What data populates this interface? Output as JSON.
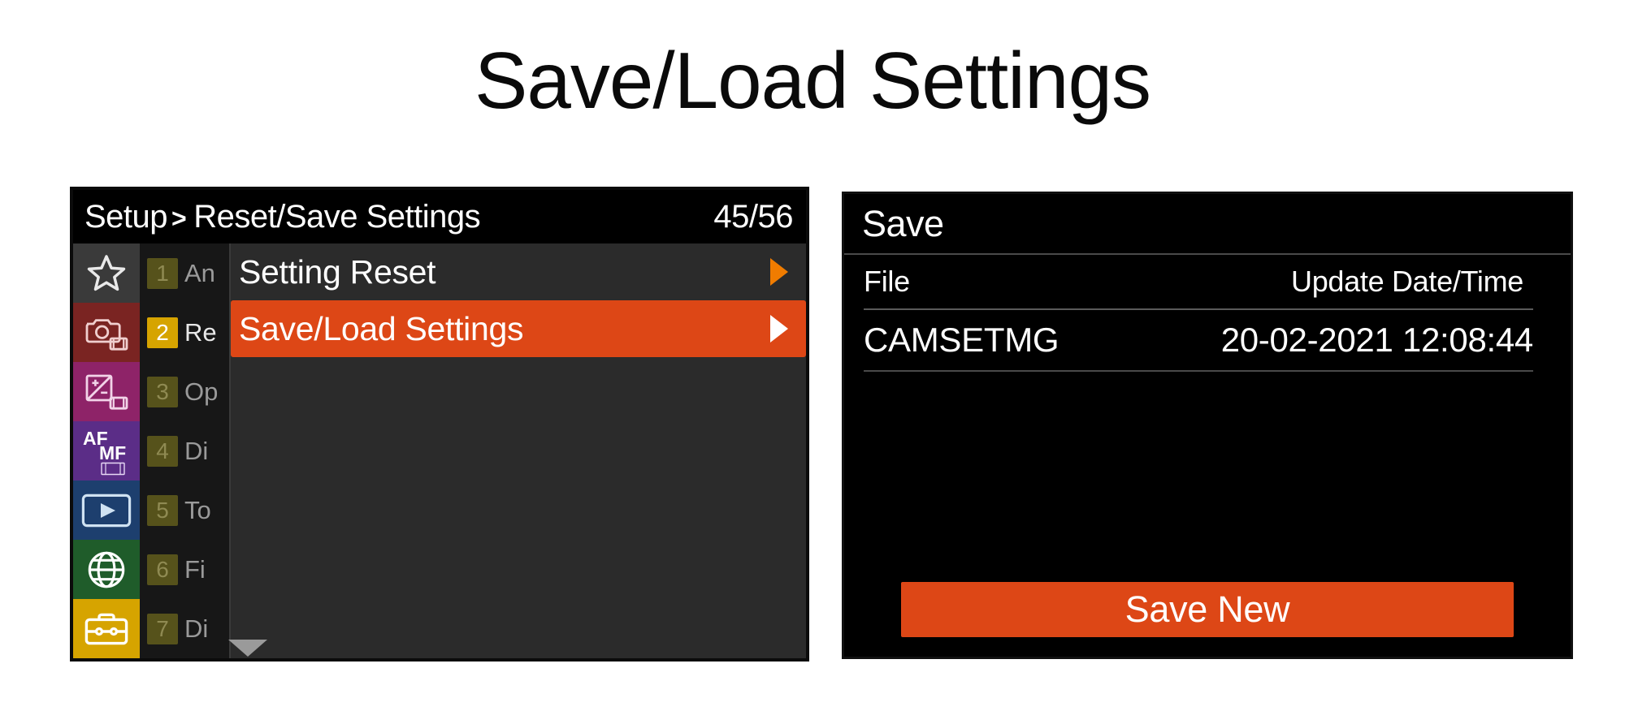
{
  "page": {
    "title": "Save/Load Settings"
  },
  "menu_panel": {
    "breadcrumb": {
      "root": "Setup",
      "separator": ">",
      "current": "Reset/Save Settings"
    },
    "page_counter": "45/56",
    "icons": [
      {
        "name": "favorites-star-icon",
        "bg": "#3a3a3a"
      },
      {
        "name": "camera-shooting-icon",
        "bg": "#7a2422"
      },
      {
        "name": "exposure-color-icon",
        "bg": "#8e2368"
      },
      {
        "name": "af-mf-focus-icon",
        "bg": "#5b2d87",
        "af": "AF",
        "mf": "MF"
      },
      {
        "name": "playback-icon",
        "bg": "#1d3f6e"
      },
      {
        "name": "network-globe-icon",
        "bg": "#1f5c2a"
      },
      {
        "name": "setup-toolbox-icon",
        "bg": "#d6a400"
      }
    ],
    "tabs": [
      {
        "number": "1",
        "label": "An",
        "active": false
      },
      {
        "number": "2",
        "label": "Re",
        "active": true
      },
      {
        "number": "3",
        "label": "Op",
        "active": false
      },
      {
        "number": "4",
        "label": "Di",
        "active": false
      },
      {
        "number": "5",
        "label": "To",
        "active": false
      },
      {
        "number": "6",
        "label": "Fi",
        "active": false
      },
      {
        "number": "7",
        "label": "Di",
        "active": false
      }
    ],
    "items": [
      {
        "label": "Setting Reset",
        "selected": false,
        "arrow": "chevron-right"
      },
      {
        "label": "Save/Load Settings",
        "selected": true,
        "arrow": "chevron-right"
      }
    ]
  },
  "save_dialog": {
    "title": "Save",
    "columns": {
      "file": "File",
      "date": "Update Date/Time"
    },
    "rows": [
      {
        "file": "CAMSETMG",
        "date": "20-02-2021 12:08:44"
      }
    ],
    "save_new_label": "Save New"
  },
  "colors": {
    "accent_orange": "#dd4716",
    "arrow_orange": "#f07c00",
    "tab_gold": "#d6a400",
    "panel_black": "#000000",
    "list_gray": "#2b2b2b"
  }
}
